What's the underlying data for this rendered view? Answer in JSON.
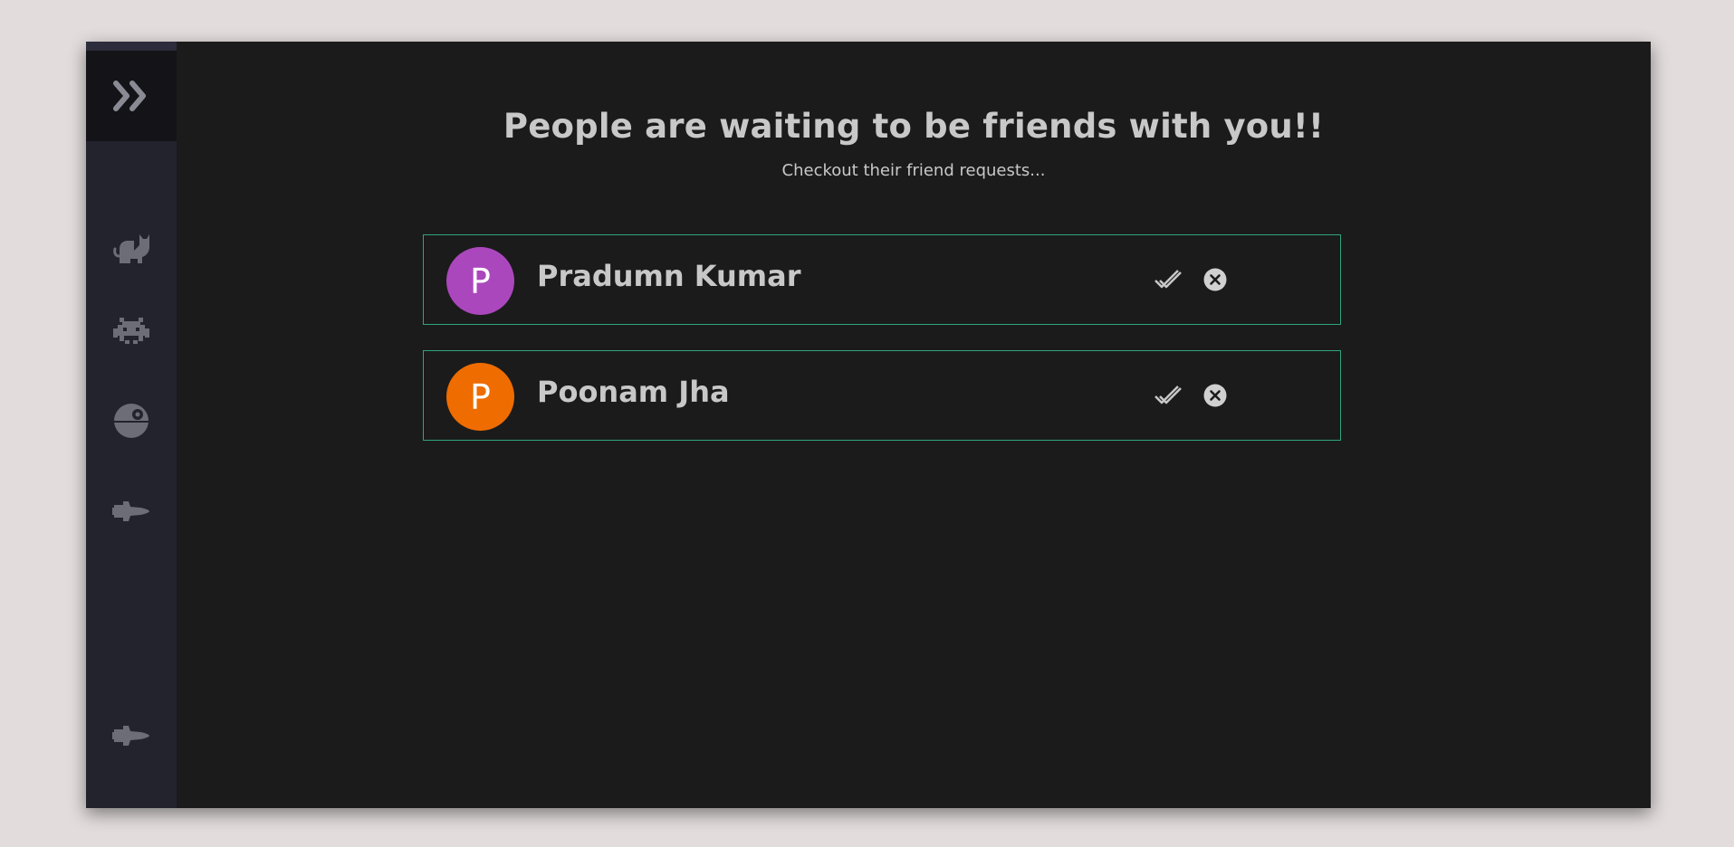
{
  "sidebar": {
    "toggle_icon": "double-chevron-right-icon",
    "items": [
      {
        "name": "cat",
        "icon": "cat-icon"
      },
      {
        "name": "space-invader",
        "icon": "space-invader-icon"
      },
      {
        "name": "death-star",
        "icon": "death-star-icon"
      },
      {
        "name": "space-shuttle",
        "icon": "space-shuttle-icon"
      }
    ],
    "bottom_item": {
      "name": "space-shuttle-bottom",
      "icon": "space-shuttle-icon"
    }
  },
  "main": {
    "title": "People are waiting to be friends with you!!",
    "subtitle": "Checkout their friend requests..."
  },
  "requests": [
    {
      "initial": "P",
      "name": "Pradumn Kumar",
      "avatar_color": "#ab47bc",
      "accept_icon": "double-check-icon",
      "decline_icon": "close-circle-icon"
    },
    {
      "initial": "P",
      "name": "Poonam Jha",
      "avatar_color": "#ef6c00",
      "accept_icon": "double-check-icon",
      "decline_icon": "close-circle-icon"
    }
  ],
  "colors": {
    "background": "#1b1b1b",
    "sidebar": "#23232e",
    "card_border": "#2ea57c",
    "text": "#c8c8c8",
    "icon": "#6d6d78"
  }
}
